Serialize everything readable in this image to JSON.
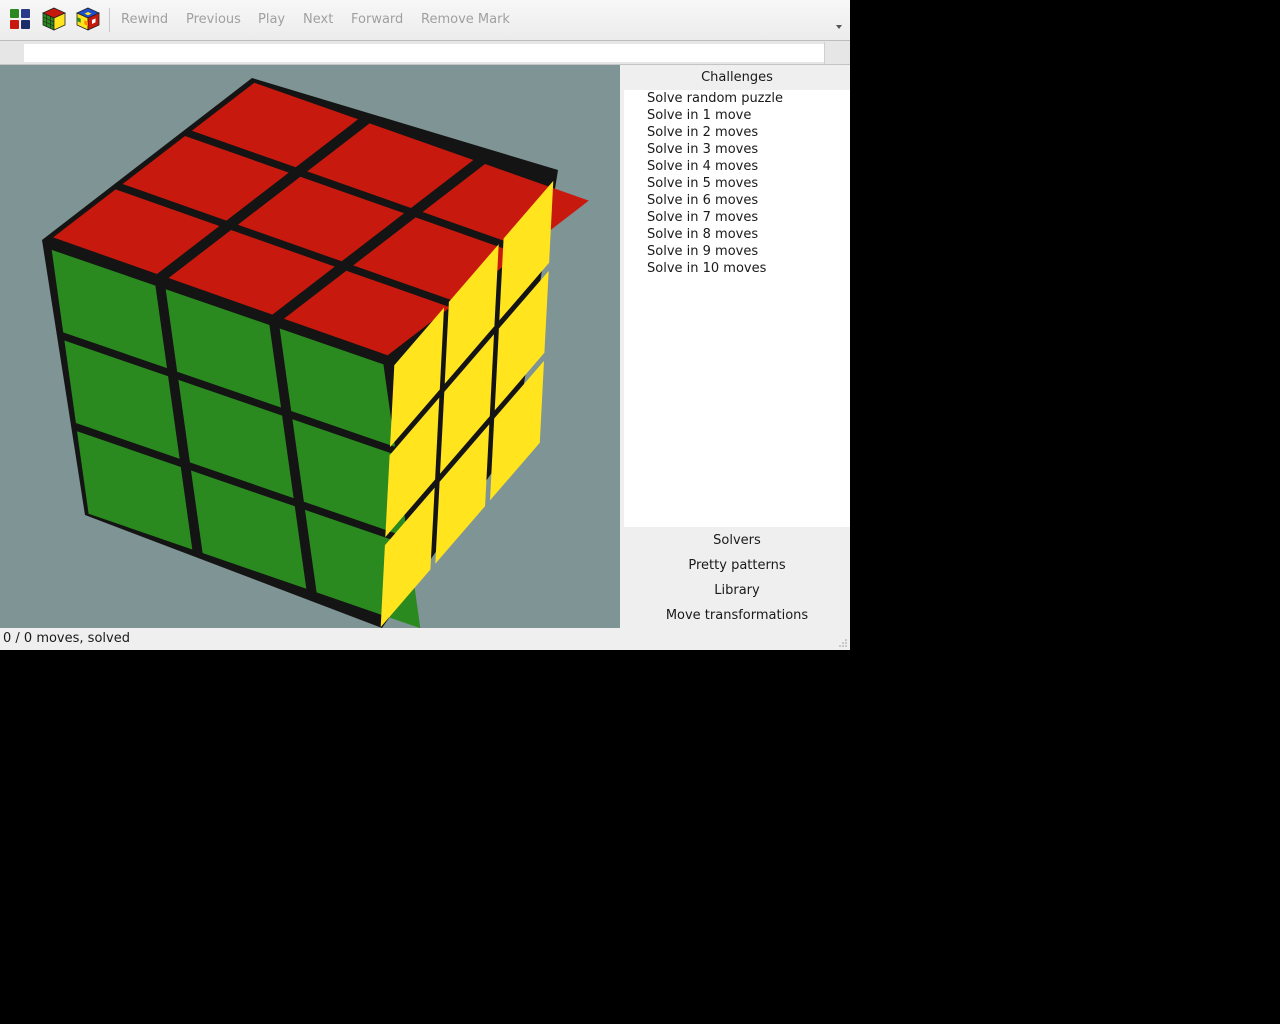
{
  "toolbar": {
    "icons": [
      "grid-icon",
      "cube-solved-icon",
      "cube-scrambled-icon"
    ],
    "buttons": [
      "Rewind",
      "Previous",
      "Play",
      "Next",
      "Forward",
      "Remove Mark"
    ]
  },
  "edit": {
    "value": ""
  },
  "cube": {
    "top_color": "#c8190e",
    "front_color": "#2a8a1f",
    "right_color": "#ffe41e",
    "background": "#7f9494"
  },
  "panel": {
    "challenges_label": "Challenges",
    "challenges": [
      "Solve random puzzle",
      "Solve in 1 move",
      "Solve in 2 moves",
      "Solve in 3 moves",
      "Solve in 4 moves",
      "Solve in 5 moves",
      "Solve in 6 moves",
      "Solve in 7 moves",
      "Solve in 8 moves",
      "Solve in 9 moves",
      "Solve in 10 moves"
    ],
    "solvers_label": "Solvers",
    "patterns_label": "Pretty patterns",
    "library_label": "Library",
    "transformations_label": "Move transformations"
  },
  "status": {
    "text": "0 / 0 moves, solved"
  }
}
